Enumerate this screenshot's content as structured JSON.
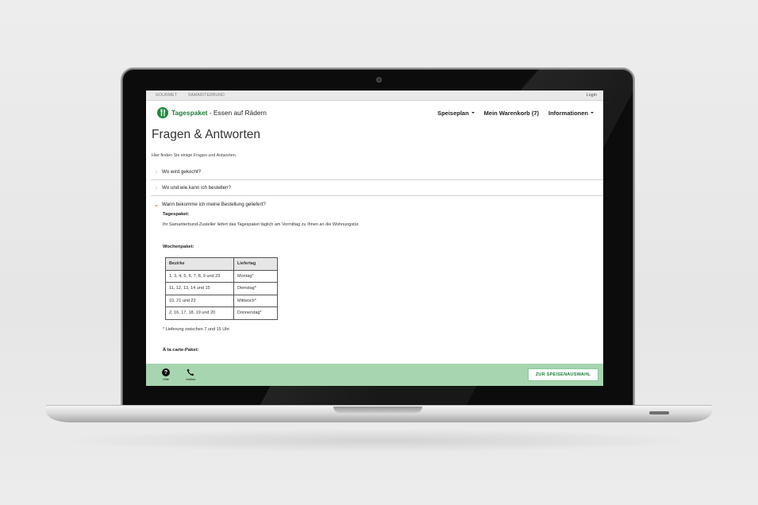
{
  "topbar": {
    "links": [
      "GOURMET",
      "SAMARITERBUND"
    ],
    "login": "Login"
  },
  "brand": {
    "name": "Tagespaket",
    "tagline": " - Essen auf Rädern",
    "logo_icon": "fork-knife-icon",
    "color": "#1e7d36"
  },
  "nav": {
    "speiseplan": "Speiseplan",
    "warenkorb": "Mein Warenkorb (7)",
    "informationen": "Informationen"
  },
  "page": {
    "title": "Fragen & Antworten",
    "intro": "Hier finden Sie einige Fragen und Antworten."
  },
  "faq": {
    "q1": "Wo wird gekocht?",
    "q2": "Wo und wie kann ich bestellen?",
    "q3": "Wann bekomme ich meine Bestellung geliefert?"
  },
  "answer": {
    "tagespaket_heading": "Tagespaket:",
    "tagespaket_text": "Ihr Samariterbund-Zusteller liefert das Tagespaket täglich am Vormittag zu Ihnen an die Wohnungstür.",
    "wochenpaket_heading": "Wochenpaket:",
    "table_headers": {
      "bezirke": "Bezirke",
      "liefertag": "Liefertag"
    },
    "rows": [
      {
        "bezirke": "1, 3, 4, 5, 6, 7, 8, 9 und 23",
        "liefertag": "Montag*"
      },
      {
        "bezirke": "11, 12, 13, 14 und 15",
        "liefertag": "Dienstag*"
      },
      {
        "bezirke": "10, 21 und 22",
        "liefertag": "Mittwoch*"
      },
      {
        "bezirke": "2, 16, 17, 18, 19 und 20",
        "liefertag": "Donnerstag*"
      }
    ],
    "footnote": "* Lieferung zwischen 7 und 15 Uhr",
    "alacarte_heading": "À la carte-Paket:"
  },
  "bottombar": {
    "hilfe": "Hilfe",
    "hotline": "Hotline",
    "cta": "ZUR SPEISENAUSWAHL",
    "color": "#a7d5b0"
  },
  "colors": {
    "accent": "#c0521a",
    "brand_green": "#1e8a3c"
  }
}
